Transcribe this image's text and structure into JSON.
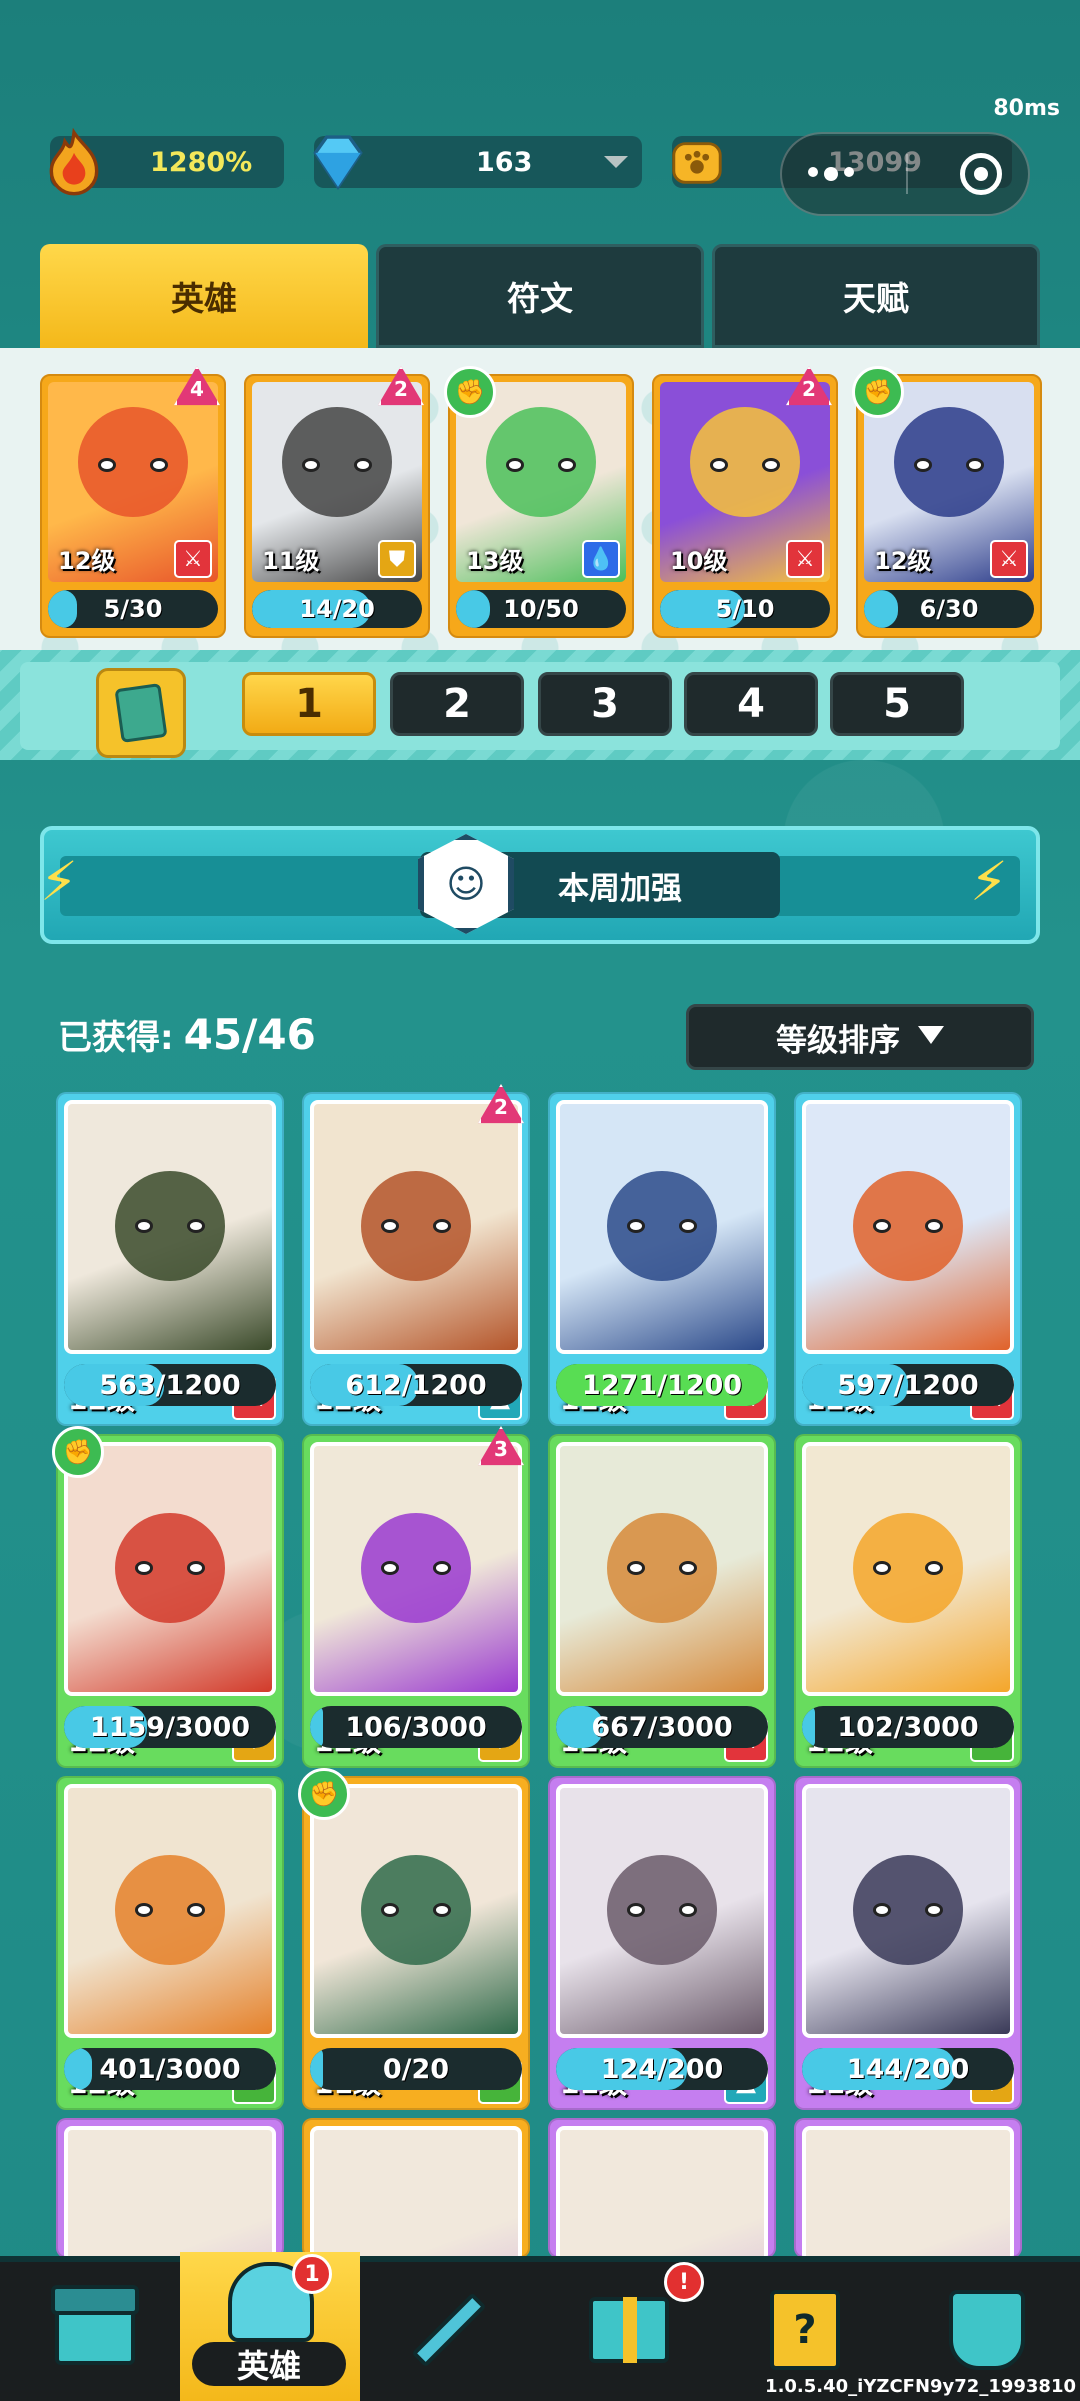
{
  "status": {
    "latency": "80ms"
  },
  "currency": {
    "power": "1280%",
    "gems": "163",
    "coins": "13099"
  },
  "tabs": [
    {
      "label": "英雄",
      "active": true
    },
    {
      "label": "符文",
      "active": false
    },
    {
      "label": "天赋",
      "active": false
    }
  ],
  "team": [
    {
      "level": "12级",
      "progress": "5/30",
      "fill": 0.17,
      "class_icon": "sword-icon",
      "badge": "star",
      "badge_value": "4",
      "colors": [
        "#ffb84a",
        "#e8552a"
      ]
    },
    {
      "level": "11级",
      "progress": "14/20",
      "fill": 0.7,
      "class_icon": "shield-icon",
      "badge": "star",
      "badge_value": "2",
      "colors": [
        "#e4e7ea",
        "#444"
      ]
    },
    {
      "level": "13级",
      "progress": "10/50",
      "fill": 0.2,
      "class_icon": "drop-icon",
      "badge": "fist",
      "badge_value": "",
      "colors": [
        "#f0e6d8",
        "#4bbf5a"
      ]
    },
    {
      "level": "10级",
      "progress": "5/10",
      "fill": 0.5,
      "class_icon": "sword-icon",
      "badge": "star",
      "badge_value": "2",
      "colors": [
        "#8a4fd8",
        "#f6c23a"
      ]
    },
    {
      "level": "12级",
      "progress": "6/30",
      "fill": 0.2,
      "class_icon": "sword-icon",
      "badge": "fist",
      "badge_value": "",
      "colors": [
        "#d8dff0",
        "#2c3c8a"
      ]
    }
  ],
  "decks": [
    "1",
    "2",
    "3",
    "4",
    "5"
  ],
  "active_deck": "1",
  "banner": {
    "title": "本周加强"
  },
  "owned": {
    "label": "已获得:",
    "count": "45/46"
  },
  "sort": {
    "label": "等级排序"
  },
  "heroes": [
    {
      "level": "12级",
      "progress": "563/1200",
      "fill": 0.47,
      "frame": "blue",
      "class_icon": "sword-icon",
      "badge": "",
      "badge_value": "",
      "colors": [
        "#efe8dc",
        "#3a4a2a"
      ]
    },
    {
      "level": "12级",
      "progress": "612/1200",
      "fill": 0.51,
      "frame": "blue",
      "class_icon": "speed-icon",
      "badge": "star",
      "badge_value": "2",
      "colors": [
        "#f1e4cf",
        "#b4552a"
      ]
    },
    {
      "level": "12级",
      "progress": "1271/1200",
      "fill": 1.0,
      "frame": "blue",
      "class_icon": "sword-icon",
      "badge": "",
      "badge_value": "",
      "colors": [
        "#d5e6f6",
        "#2c4a8a"
      ],
      "full": true
    },
    {
      "level": "12级",
      "progress": "597/1200",
      "fill": 0.5,
      "frame": "blue",
      "class_icon": "sword-icon",
      "badge": "",
      "badge_value": "",
      "colors": [
        "#dde8f8",
        "#e0622a"
      ]
    },
    {
      "level": "12级",
      "progress": "1159/3000",
      "fill": 0.39,
      "frame": "green",
      "class_icon": "shield-icon",
      "badge": "fist",
      "badge_value": "",
      "colors": [
        "#f3dccf",
        "#d23a2a"
      ]
    },
    {
      "level": "12级",
      "progress": "106/3000",
      "fill": 0.04,
      "frame": "green",
      "class_icon": "shield-icon",
      "badge": "star",
      "badge_value": "3",
      "colors": [
        "#f0e8d8",
        "#9a3ad0"
      ]
    },
    {
      "level": "12级",
      "progress": "667/3000",
      "fill": 0.22,
      "frame": "green",
      "class_icon": "sword-icon",
      "badge": "",
      "badge_value": "",
      "colors": [
        "#e7ead8",
        "#d6893a"
      ]
    },
    {
      "level": "12级",
      "progress": "102/3000",
      "fill": 0.03,
      "frame": "green",
      "class_icon": "heal-icon",
      "badge": "",
      "badge_value": "",
      "colors": [
        "#f2e8d2",
        "#f4a62a"
      ]
    },
    {
      "level": "12级",
      "progress": "401/3000",
      "fill": 0.13,
      "frame": "green",
      "class_icon": "heal-icon",
      "badge": "",
      "badge_value": "",
      "colors": [
        "#f0e4d0",
        "#e5812a"
      ]
    },
    {
      "level": "11级",
      "progress": "0/20",
      "fill": 0.0,
      "frame": "orange",
      "class_icon": "heal-icon",
      "badge": "fist",
      "badge_value": "",
      "colors": [
        "#f1e6d8",
        "#2f6a4a"
      ]
    },
    {
      "level": "11级",
      "progress": "124/200",
      "fill": 0.62,
      "frame": "purple",
      "class_icon": "speed-icon",
      "badge": "",
      "badge_value": "",
      "colors": [
        "#e8e2ea",
        "#6a5a6a"
      ]
    },
    {
      "level": "11级",
      "progress": "144/200",
      "fill": 0.72,
      "frame": "purple",
      "class_icon": "shield-icon",
      "badge": "",
      "badge_value": "",
      "colors": [
        "#e6e4ee",
        "#3a3a58"
      ]
    }
  ],
  "nav": {
    "items": [
      "shop",
      "hero",
      "battle",
      "gift",
      "quest",
      "guild"
    ],
    "hero_label": "英雄",
    "hero_badge": "1",
    "gift_badge": "!"
  },
  "version": "1.0.5.40_iYZCFN9y72_1993810",
  "icons": {
    "power": "flame-icon",
    "gems": "diamond-icon",
    "coins": "paw-coin-icon"
  }
}
